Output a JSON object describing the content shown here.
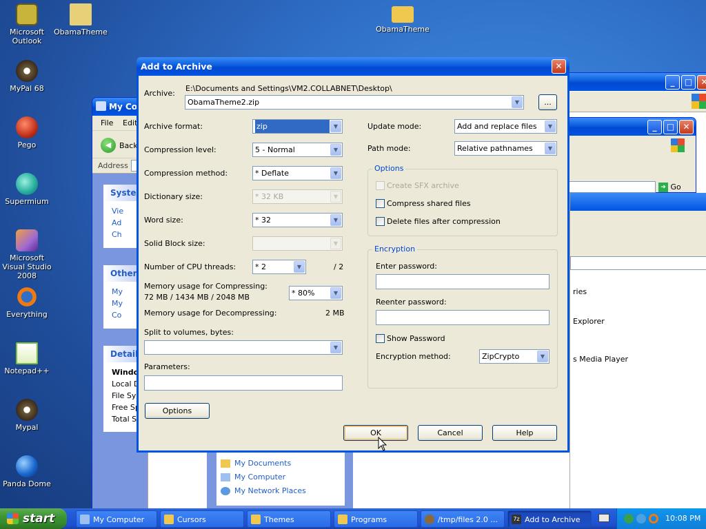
{
  "desktop": {
    "icons": [
      {
        "label": "Microsoft Outlook",
        "color": "#c8b43a"
      },
      {
        "label": "ObamaTheme",
        "color": "#e8d078"
      },
      {
        "label": "ObamaTheme",
        "color": "#f0c850"
      },
      {
        "label": "MyPal 68",
        "color": "#6a5a3a"
      },
      {
        "label": "Pego",
        "color": "#c0301a"
      },
      {
        "label": "Supermium",
        "color": "#2ab0a0"
      },
      {
        "label": "Microsoft Visual Studio 2008",
        "color": "#a06ad0"
      },
      {
        "label": "Everything",
        "color": "#f07a10"
      },
      {
        "label": "Notepad++",
        "color": "#7ac040"
      },
      {
        "label": "Mypal",
        "color": "#6a5a3a"
      },
      {
        "label": "Panda Dome",
        "color": "#1a6ad0"
      }
    ]
  },
  "explorer": {
    "title": "My Co",
    "menu_file": "File",
    "menu_edit": "Edit",
    "back": "Back",
    "address": "Address",
    "go": "Go",
    "system_tasks": "Syster",
    "system_links": [
      "Vie",
      "Ad",
      "Ch"
    ],
    "other_places": "Other",
    "other_links": [
      "My",
      "My",
      "Co"
    ],
    "details": "Details",
    "details_lines": [
      "Windo",
      "Local D",
      "File Sys",
      "Free Sp",
      "Total Si"
    ],
    "bottom_links": [
      "My Documents",
      "My Computer",
      "My Network Places"
    ],
    "right_items": [
      "ries",
      "Explorer",
      "s Media Player"
    ]
  },
  "dialog": {
    "title": "Add to Archive",
    "archive_label": "Archive:",
    "archive_path": "E:\\Documents and Settings\\VM2.COLLABNET\\Desktop\\",
    "archive_name": "ObamaTheme2.zip",
    "browse_label": "...",
    "archive_format_label": "Archive format:",
    "archive_format": "zip",
    "compression_level_label": "Compression level:",
    "compression_level": "5 - Normal",
    "compression_method_label": "Compression method:",
    "compression_method": "* Deflate",
    "dictionary_size_label": "Dictionary size:",
    "dictionary_size": "* 32 KB",
    "word_size_label": "Word size:",
    "word_size": "* 32",
    "solid_block_label": "Solid Block size:",
    "solid_block": "",
    "cpu_threads_label": "Number of CPU threads:",
    "cpu_threads": "* 2",
    "cpu_threads_max": "/ 2",
    "mem_compress_label": "Memory usage for Compressing:",
    "mem_compress_value": "72 MB / 1434 MB / 2048 MB",
    "mem_compress_percent": "* 80%",
    "mem_decompress_label": "Memory usage for Decompressing:",
    "mem_decompress_value": "2 MB",
    "split_label": "Split to volumes, bytes:",
    "split_value": "",
    "parameters_label": "Parameters:",
    "parameters_value": "",
    "options_button": "Options",
    "update_mode_label": "Update mode:",
    "update_mode": "Add and replace files",
    "path_mode_label": "Path mode:",
    "path_mode": "Relative pathnames",
    "options_group": "Options",
    "create_sfx": "Create SFX archive",
    "compress_shared": "Compress shared files",
    "delete_after": "Delete files after compression",
    "encryption_group": "Encryption",
    "enter_password_label": "Enter password:",
    "reenter_password_label": "Reenter password:",
    "show_password": "Show Password",
    "encryption_method_label": "Encryption method:",
    "encryption_method": "ZipCrypto",
    "ok": "OK",
    "cancel": "Cancel",
    "help": "Help"
  },
  "taskbar": {
    "start": "start",
    "buttons": [
      {
        "label": "My Computer",
        "color": "#9ec0f0"
      },
      {
        "label": "Cursors",
        "color": "#f0c850"
      },
      {
        "label": "Themes",
        "color": "#f0c850"
      },
      {
        "label": "Programs",
        "color": "#f0c850"
      },
      {
        "label": "/tmp/files 2.0 ...",
        "color": "#8a6a3a"
      },
      {
        "label": "Add to Archive",
        "color": "#333333"
      }
    ],
    "clock": "10:08 PM"
  }
}
